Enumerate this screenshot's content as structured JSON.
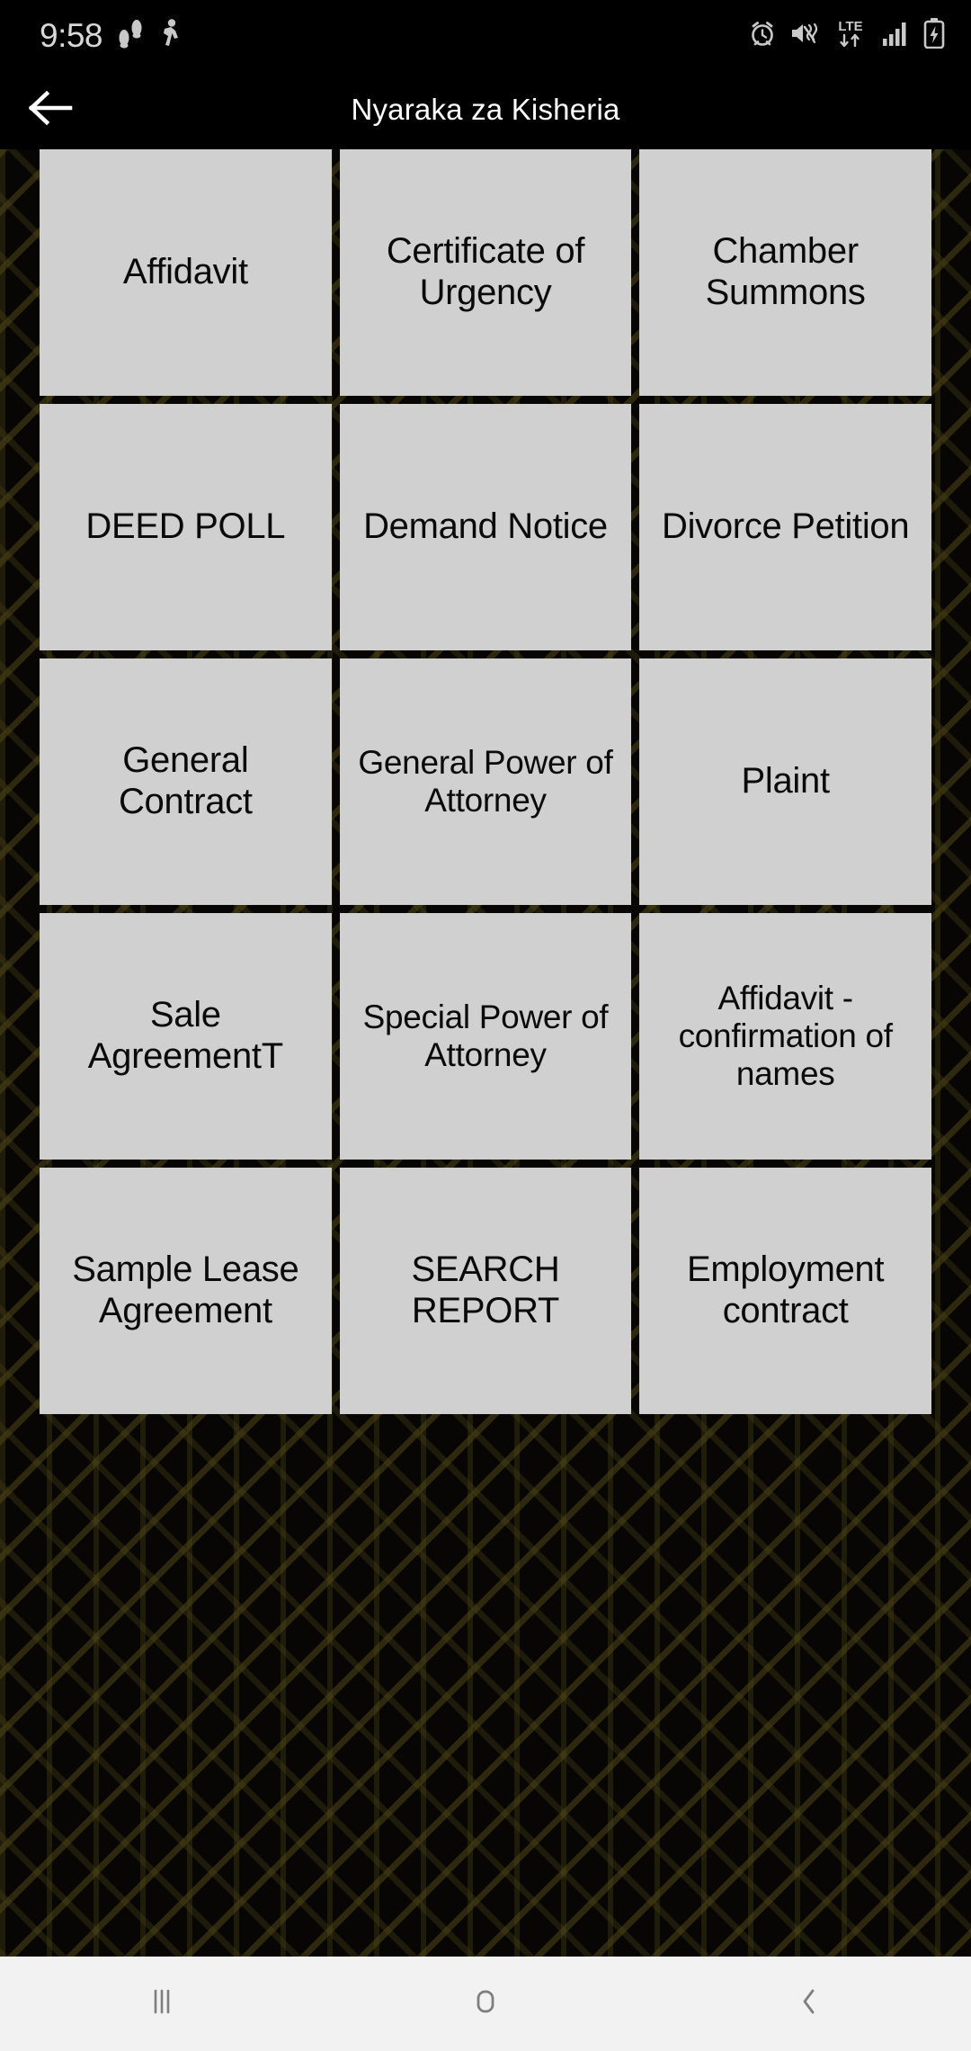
{
  "status_bar": {
    "time": "9:58",
    "left_icons": [
      "footsteps-icon",
      "activity-person-icon"
    ],
    "right_icons": [
      "alarm-clock-icon",
      "sound-mute-vibrate-icon",
      "lte-data-icon",
      "signal-bars-icon",
      "battery-charging-icon"
    ],
    "network_label": "LTE",
    "text_color": "#d8d8d8",
    "background": "#000000"
  },
  "app_bar": {
    "back_icon": "arrow-left-icon",
    "title": "Nyaraka za Kisheria",
    "background": "#000000",
    "title_color": "#ffffff"
  },
  "grid": {
    "columns": 3,
    "tile_background": "#d0d0d0",
    "tile_text_color": "#0a0a0a",
    "items": [
      {
        "label": "Affidavit"
      },
      {
        "label": "Certificate of Urgency"
      },
      {
        "label": "Chamber Summons"
      },
      {
        "label": "DEED POLL"
      },
      {
        "label": "Demand Notice"
      },
      {
        "label": "Divorce Petition"
      },
      {
        "label": "General Contract"
      },
      {
        "label": "General Power of Attorney"
      },
      {
        "label": "Plaint"
      },
      {
        "label": "Sale AgreementT"
      },
      {
        "label": "Special Power of Attorney"
      },
      {
        "label": "Affidavit - confirmation of names"
      },
      {
        "label": "Sample Lease Agreement"
      },
      {
        "label": "SEARCH REPORT"
      },
      {
        "label": "Employment contract"
      }
    ]
  },
  "nav_bar": {
    "background": "#f2f2f2",
    "icon_color": "#7a7a7a",
    "buttons": [
      {
        "name": "recents-icon",
        "label": "Recents"
      },
      {
        "name": "home-icon",
        "label": "Home"
      },
      {
        "name": "back-icon",
        "label": "Back"
      }
    ]
  }
}
